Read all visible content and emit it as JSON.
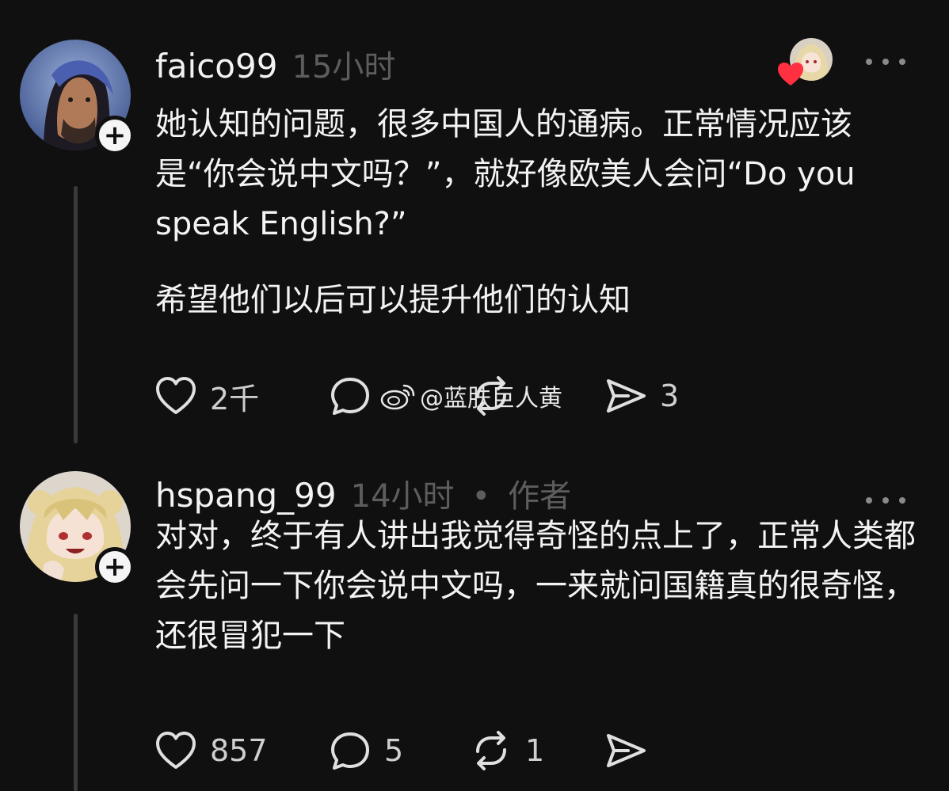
{
  "posts": [
    {
      "username": "faico99",
      "time": "15小时",
      "role": "",
      "paragraphs": [
        "她认知的问题，很多中国人的通病。正常情况应该是“你会说中文吗？”，就好像欧美人会问“Do you speak English?”",
        "希望他们以后可以提升他们的认知"
      ],
      "likes": "2千",
      "comments": "",
      "reposts": "",
      "shares": "3"
    },
    {
      "username": "hspang_99",
      "time": "14小时",
      "role": "作者",
      "paragraphs": [
        "对对，终于有人讲出我觉得奇怪的点上了，正常人类都会先问一下你会说中文吗，一来就问国籍真的很奇怪，还很冒犯一下"
      ],
      "likes": "857",
      "comments": "5",
      "reposts": "1",
      "shares": ""
    }
  ],
  "watermark": "@蓝肤巨人黄",
  "icons": {
    "like": "heart-outline-icon",
    "comment": "comment-bubble-icon",
    "repost": "repost-arrows-icon",
    "share": "send-arrow-icon",
    "more": "more-dots-icon",
    "follow": "plus-icon"
  },
  "colors": {
    "background": "#101010",
    "text": "#f3f3f3",
    "muted": "#5d5d5d",
    "heart": "#ff3040"
  }
}
